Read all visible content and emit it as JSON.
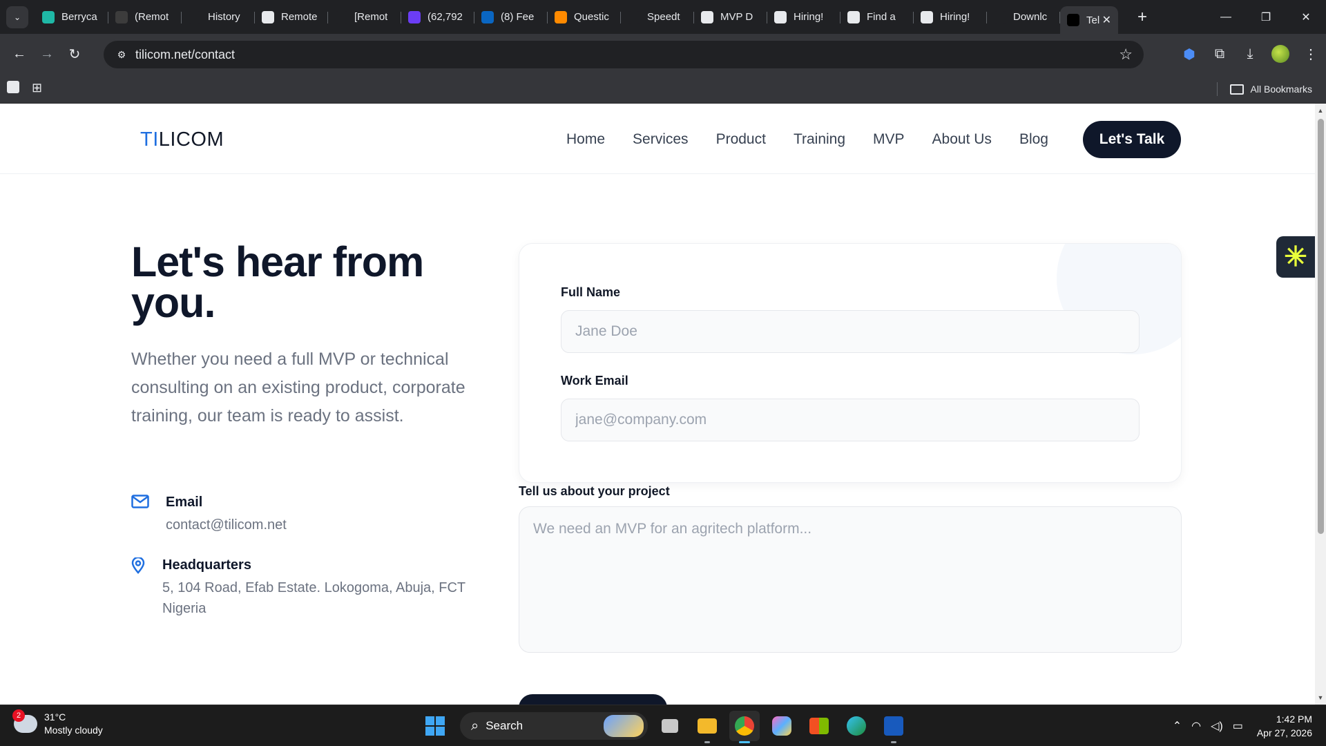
{
  "browser": {
    "tabs": [
      {
        "label": "Berryca",
        "icon": "berrycast-icon",
        "color": "#1fb8a6"
      },
      {
        "label": "(Remot",
        "icon": "wordpress-icon",
        "color": "#3c3c3c"
      },
      {
        "label": "History",
        "icon": "history-icon",
        "color": "#202124"
      },
      {
        "label": "Remote",
        "icon": "remote-icon",
        "color": "#e8eaed"
      },
      {
        "label": "[Remot",
        "icon": "globe-icon",
        "color": "#202124"
      },
      {
        "label": "(62,792",
        "icon": "mail-icon",
        "color": "#6b3df5"
      },
      {
        "label": "(8) Fee",
        "icon": "linkedin-icon",
        "color": "#0a66c2"
      },
      {
        "label": "Questic",
        "icon": "cube-icon",
        "color": "#ff8a00"
      },
      {
        "label": "Speedt",
        "icon": "speedometer-icon",
        "color": "#202124"
      },
      {
        "label": "MVP D",
        "icon": "openai-icon",
        "color": "#e8eaed"
      },
      {
        "label": "Hiring!",
        "icon": "page-icon",
        "color": "#e8eaed"
      },
      {
        "label": "Find a",
        "icon": "page-icon",
        "color": "#e8eaed"
      },
      {
        "label": "Hiring!",
        "icon": "page-icon",
        "color": "#e8eaed"
      },
      {
        "label": "Downlc",
        "icon": "globe-icon",
        "color": "#202124"
      }
    ],
    "active_tab": {
      "label": "Tel",
      "icon": "tilicom-favicon",
      "close": "✕"
    },
    "new_tab": "+",
    "url": "tilicom.net/contact",
    "bookmarks_label": "All Bookmarks"
  },
  "site": {
    "logo_accent": "TI",
    "logo_rest": "LICOM",
    "nav": [
      "Home",
      "Services",
      "Product",
      "Training",
      "MVP",
      "About Us",
      "Blog"
    ],
    "cta": "Let's Talk",
    "hero_title": "Let's hear from you.",
    "hero_sub": "Whether you need a full MVP or technical consulting on an existing product, corporate training, our team is ready to assist.",
    "email_title": "Email",
    "email_value": "contact@tilicom.net",
    "hq_title": "Headquarters",
    "hq_value": "5, 104 Road, Efab Estate. Lokogoma, Abuja, FCT Nigeria"
  },
  "form": {
    "name_label": "Full Name",
    "name_placeholder": "Jane Doe",
    "email_label": "Work Email",
    "email_placeholder": "jane@company.com",
    "project_label": "Tell us about your project",
    "project_placeholder": "We need an MVP for an agritech platform..."
  },
  "taskbar": {
    "weather_badge": "2",
    "temperature": "31°C",
    "condition": "Mostly cloudy",
    "search": "Search",
    "time": "1:42 PM",
    "date": "Apr 27, 2026"
  },
  "colors": {
    "brand_blue": "#1f6fe0",
    "navy": "#0f172a"
  }
}
